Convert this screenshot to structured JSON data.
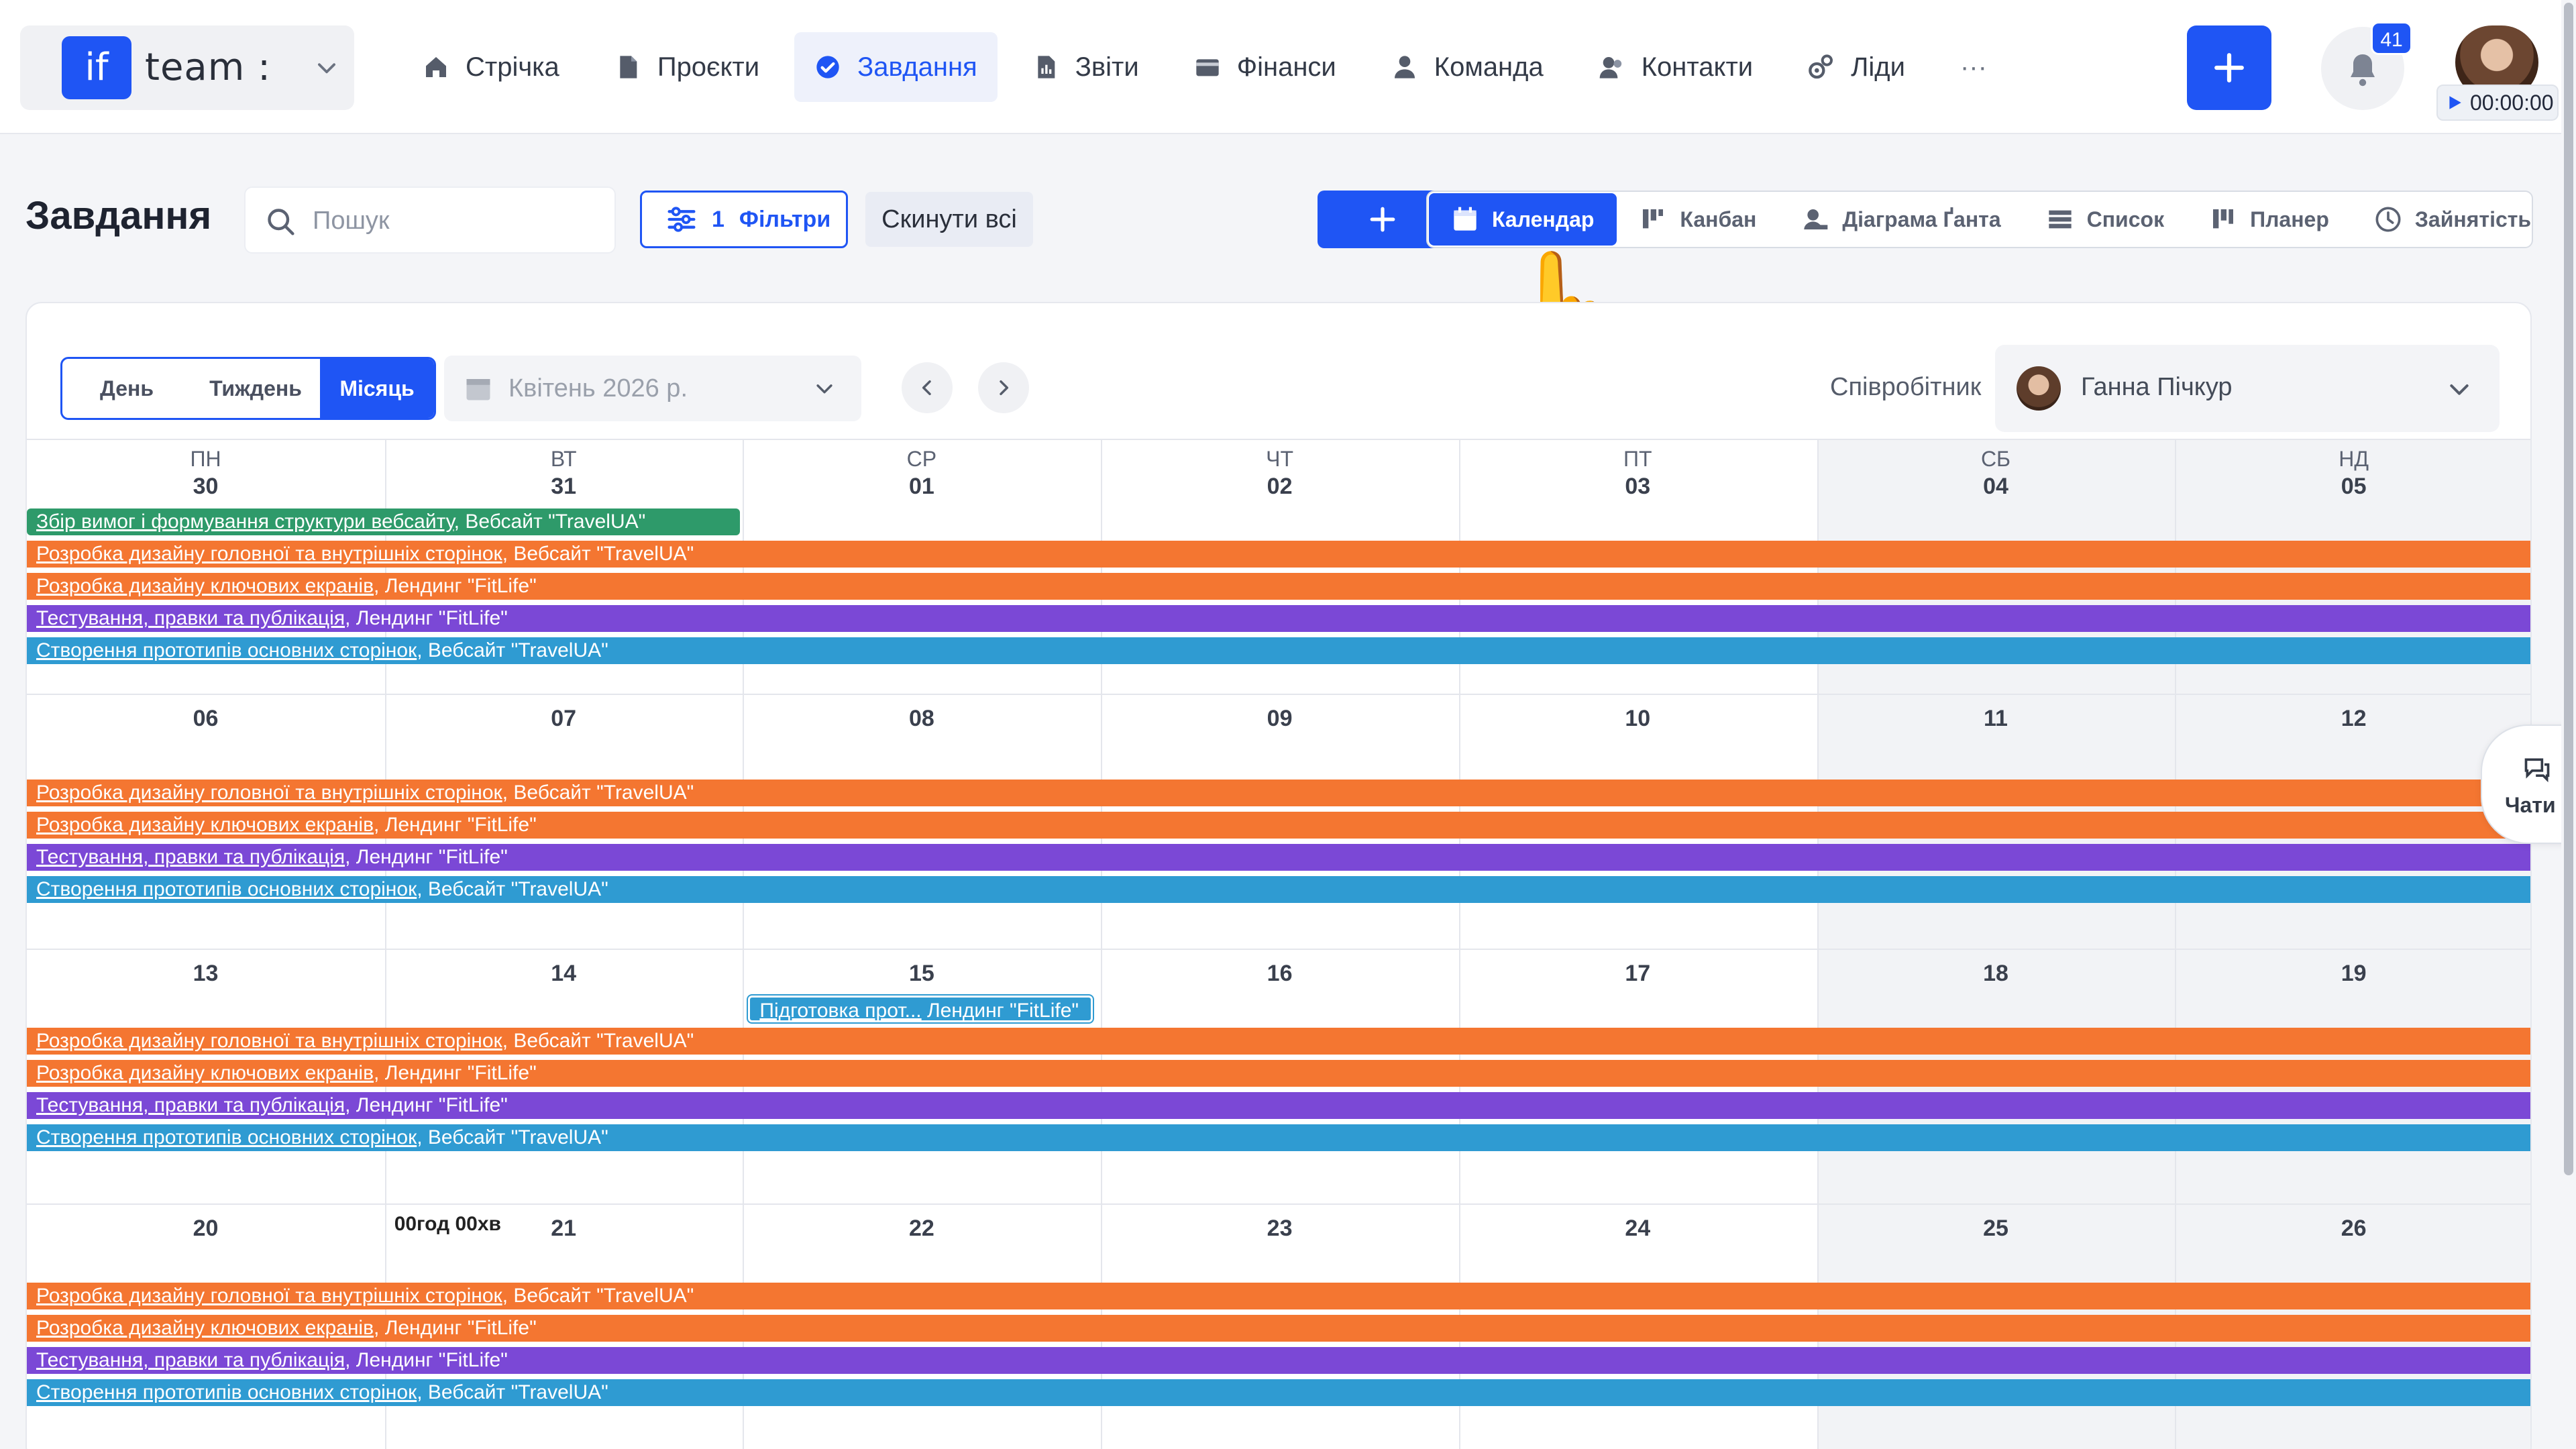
{
  "brand": {
    "logo": "if",
    "name": "team :",
    "icon": "chevron-down-icon"
  },
  "nav": [
    {
      "label": "Стрічка",
      "icon": "home-icon",
      "active": false
    },
    {
      "label": "Проєкти",
      "icon": "document-icon",
      "active": false
    },
    {
      "label": "Завдання",
      "icon": "check-circle-icon",
      "active": true
    },
    {
      "label": "Звіти",
      "icon": "report-icon",
      "active": false
    },
    {
      "label": "Фінанси",
      "icon": "wallet-icon",
      "active": false
    },
    {
      "label": "Команда",
      "icon": "user-icon",
      "active": false
    },
    {
      "label": "Контакти",
      "icon": "contacts-icon",
      "active": false
    },
    {
      "label": "Ліди",
      "icon": "leads-icon",
      "active": false
    },
    {
      "label": "···",
      "icon": "more-icon",
      "active": false
    }
  ],
  "top_actions": {
    "add_icon": "plus-icon",
    "notifications_count": "41",
    "timer": "00:00:00"
  },
  "page": {
    "title": "Завдання",
    "search_placeholder": "Пошук",
    "filters_count": "1",
    "filters_label": "Фільтри",
    "reset_label": "Скинути всі"
  },
  "views": [
    {
      "label": "Календар",
      "icon": "calendar-icon",
      "active": true
    },
    {
      "label": "Канбан",
      "icon": "kanban-icon",
      "active": false
    },
    {
      "label": "Діаграма Ґанта",
      "icon": "gantt-icon",
      "active": false
    },
    {
      "label": "Список",
      "icon": "list-icon",
      "active": false
    },
    {
      "label": "Планер",
      "icon": "planner-icon",
      "active": false
    },
    {
      "label": "Зайнятість",
      "icon": "clock-icon",
      "active": false
    }
  ],
  "pointer": "👆",
  "calendar": {
    "ranges": [
      "День",
      "Тиждень",
      "Місяць"
    ],
    "active_range": "Місяць",
    "month": "Квітень 2026 р.",
    "employee_label": "Співробітник",
    "employee": "Ганна Пічкур",
    "weekdays": [
      "ПН",
      "ВТ",
      "СР",
      "ЧТ",
      "ПТ",
      "СБ",
      "НД"
    ],
    "weeks": [
      [
        "30",
        "31",
        "01",
        "02",
        "03",
        "04",
        "05"
      ],
      [
        "06",
        "07",
        "08",
        "09",
        "10",
        "11",
        "12"
      ],
      [
        "13",
        "14",
        "15",
        "16",
        "17",
        "18",
        "19"
      ],
      [
        "20",
        "21",
        "22",
        "23",
        "24",
        "25",
        "26"
      ]
    ],
    "time_note": "00год 00хв",
    "tasks": [
      {
        "title": "Збір вимог і формування структури вебсайту",
        "project": "Вебсайт \"TravelUA\"",
        "color": "#2e9a6a",
        "week": 0,
        "start": 0,
        "end": 1
      },
      {
        "title": "Розробка дизайну головної та внутрішніх сторінок",
        "project": "Вебсайт \"TravelUA\"",
        "color": "#f47631",
        "weeks": [
          0,
          1,
          2,
          3
        ]
      },
      {
        "title": "Розробка дизайну ключових екранів",
        "project": "Лендинг \"FitLife\"",
        "color": "#f47631",
        "weeks": [
          0,
          1,
          2,
          3
        ]
      },
      {
        "title": "Тестування, правки та публікація",
        "project": "Лендинг \"FitLife\"",
        "color": "#7b48d6",
        "weeks": [
          0,
          1,
          2,
          3
        ]
      },
      {
        "title": "Створення прототипів основних сторінок",
        "project": "Вебсайт \"TravelUA\"",
        "color": "#2f9bd2",
        "weeks": [
          0,
          1,
          2,
          3
        ]
      },
      {
        "title": "Підготовка прот...",
        "project": "Лендинг \"FitLife\"",
        "color": "#2f9bd2",
        "week": 2,
        "start": 2,
        "end": 2
      }
    ]
  },
  "chats": {
    "label": "Чати",
    "icon": "chat-icon"
  }
}
